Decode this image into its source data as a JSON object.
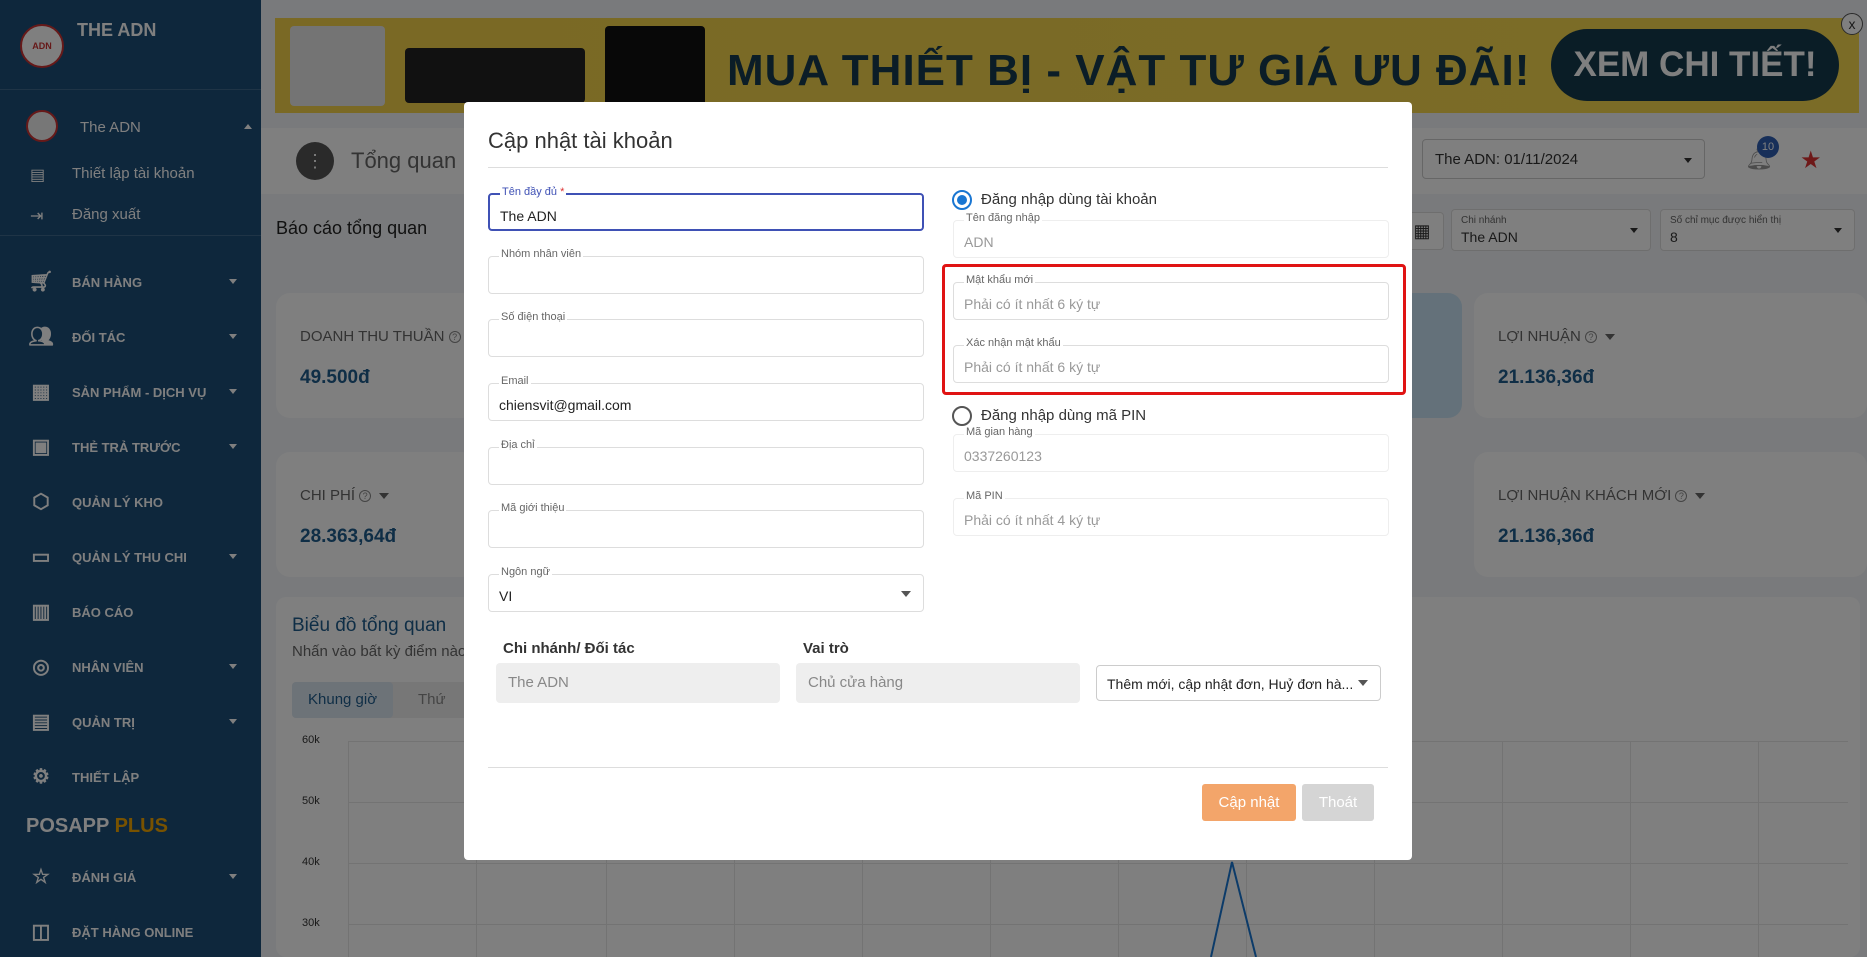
{
  "app": {
    "brand": "THE ADN",
    "logo_text": "ADN"
  },
  "sidebar": {
    "user": "The ADN",
    "sub": [
      {
        "label": "Thiết lập tài khoản"
      },
      {
        "label": "Đăng xuất"
      }
    ],
    "items": [
      {
        "label": "BÁN HÀNG"
      },
      {
        "label": "ĐỐI TÁC"
      },
      {
        "label": "SẢN PHẨM - DỊCH VỤ"
      },
      {
        "label": "THẺ TRẢ TRƯỚC"
      },
      {
        "label": "QUẢN LÝ KHO"
      },
      {
        "label": "QUẢN LÝ THU CHI"
      },
      {
        "label": "BÁO CÁO"
      },
      {
        "label": "NHÂN VIÊN"
      },
      {
        "label": "QUẢN TRỊ"
      },
      {
        "label": "THIẾT LẬP"
      }
    ],
    "posapp": "POSAPP",
    "plus": "PLUS",
    "items2": [
      {
        "label": "ĐÁNH GIÁ"
      },
      {
        "label": "ĐẶT HÀNG ONLINE"
      }
    ]
  },
  "banner": {
    "text": "MUA THIẾT BỊ - VẬT TƯ GIÁ ƯU ĐÃI!",
    "button": "XEM CHI TIẾT!",
    "close": "x"
  },
  "header": {
    "title": "Tổng quan",
    "period": "The ADN: 01/11/2024",
    "notif_count": "10"
  },
  "report": {
    "title": "Báo cáo tổng quan",
    "branch_label": "Chi nhánh",
    "branch_value": "The ADN",
    "count_label": "Số chỉ mục được hiển thị",
    "count_value": "8"
  },
  "cards": [
    {
      "label": "DOANH THU THUẦN",
      "value": "49.500đ"
    },
    {
      "label": "LỢI NHUẬN",
      "value": "21.136,36đ"
    },
    {
      "label": "CHI PHÍ",
      "value": "28.363,64đ"
    },
    {
      "label": "LỢI NHUẬN KHÁCH MỚI",
      "value": "21.136,36đ"
    }
  ],
  "chart": {
    "title": "Biểu đồ tổng quan",
    "subtitle": "Nhấn vào bất kỳ điểm nào",
    "tabs": [
      "Khung giờ",
      "Thứ"
    ],
    "yticks": [
      "60k",
      "50k",
      "40k",
      "30k"
    ]
  },
  "chart_data": {
    "type": "line",
    "title": "Biểu đồ tổng quan",
    "ylim": [
      0,
      60000
    ],
    "yticks": [
      30000,
      40000,
      50000,
      60000
    ],
    "grid": true
  },
  "modal": {
    "title": "Cập nhật tài khoản",
    "fullname_label": "Tên đầy đủ",
    "required": "*",
    "fullname_value": "The ADN",
    "group_label": "Nhóm nhân viên",
    "phone_label": "Số điện thoại",
    "email_label": "Email",
    "email_value": "chiensvit@gmail.com",
    "address_label": "Địa chỉ",
    "referral_label": "Mã giới thiệu",
    "lang_label": "Ngôn ngữ",
    "lang_value": "VI",
    "login_account": "Đăng nhập dùng tài khoản",
    "username_label": "Tên đăng nhập",
    "username_value": "ADN",
    "newpass_label": "Mật khẩu mới",
    "newpass_placeholder": "Phải có ít nhất 6 ký tự",
    "confirm_label": "Xác nhận mật khẩu",
    "confirm_placeholder": "Phải có ít nhất 6 ký tự",
    "login_pin": "Đăng nhập dùng mã PIN",
    "stall_label": "Mã gian hàng",
    "stall_value": "0337260123",
    "pin_label": "Mã PIN",
    "pin_placeholder": "Phải có ít nhất 4 ký tự",
    "col_branch": "Chi nhánh/ Đối tác",
    "col_role": "Vai trò",
    "branch_value": "The ADN",
    "role_value": "Chủ cửa hàng",
    "perm_value": "Thêm mới, cập nhật đơn, Huỷ đơn hà...",
    "save": "Cập nhật",
    "exit": "Thoát"
  }
}
